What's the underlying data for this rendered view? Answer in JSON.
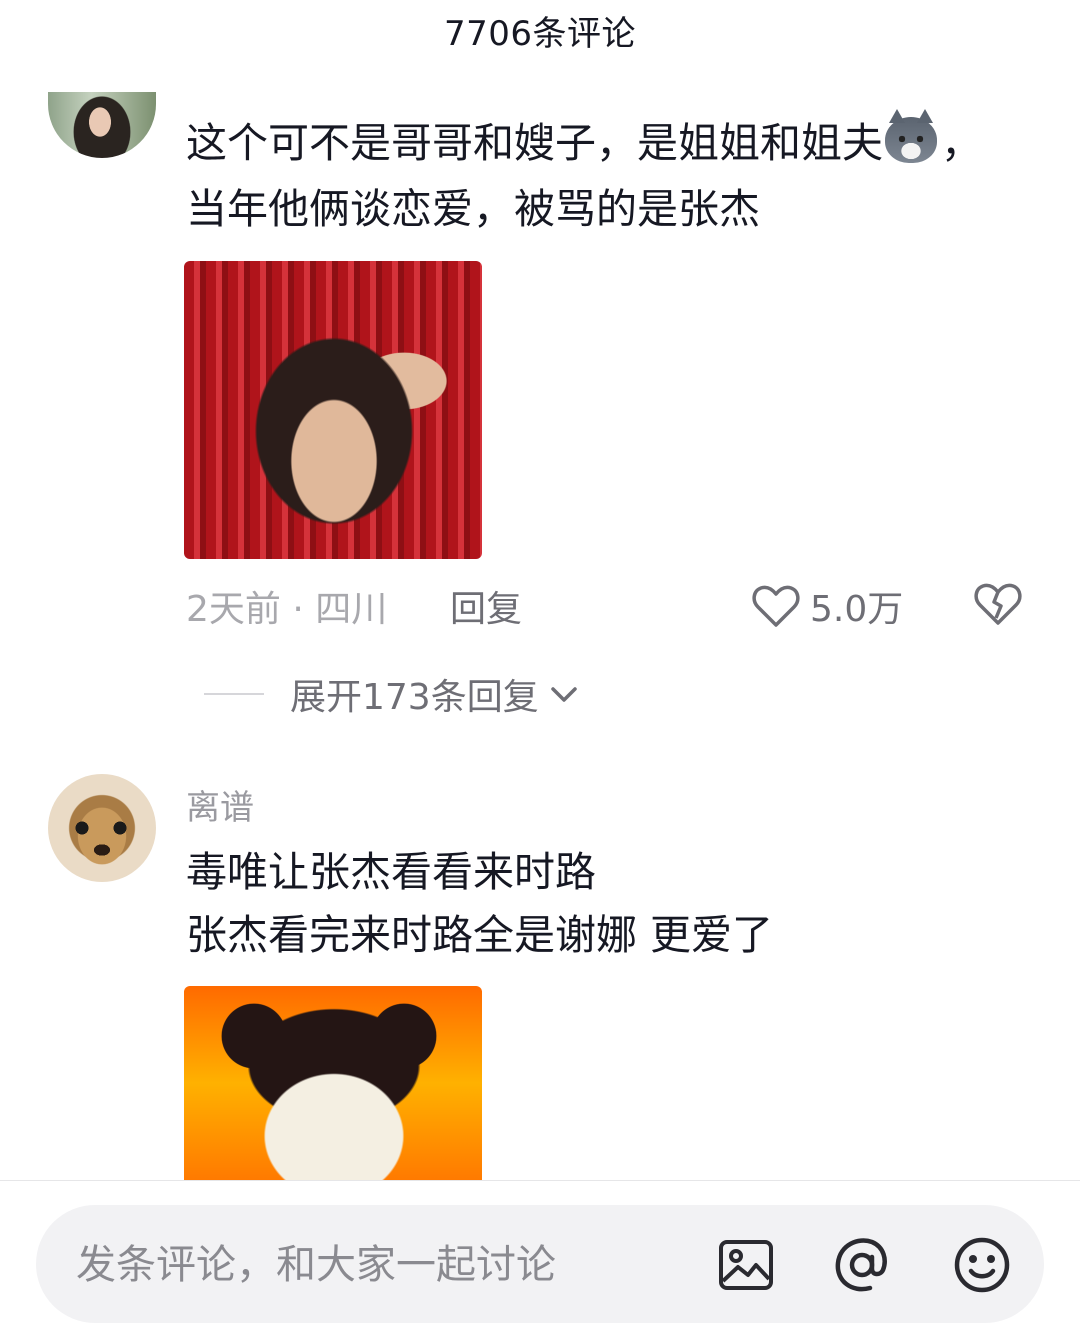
{
  "header": {
    "title": "7706条评论"
  },
  "comments": [
    {
      "username": "",
      "text_part1": "这个可不是哥哥和嫂子，是姐姐和姐夫",
      "text_part2": "，\n当年他俩谈恋爱，被骂的是张杰",
      "emoji": "wolf-face-emoji",
      "time_location": "2天前 · 四川",
      "reply_label": "回复",
      "likes": "5.0万",
      "expand_label": "展开173条回复"
    },
    {
      "username": "离谱",
      "text": "毒唯让张杰看看来时路\n张杰看完来时路全是谢娜 更爱了"
    }
  ],
  "input": {
    "placeholder": "发条评论，和大家一起讨论"
  },
  "icons": {
    "like": "heart-outline-icon",
    "dislike": "broken-heart-icon",
    "expand": "chevron-down-icon",
    "image": "image-icon",
    "mention": "at-icon",
    "emoji": "smiley-icon"
  },
  "colors": {
    "text": "#161823",
    "secondary": "#a8a8ad",
    "input_bg": "#f2f2f4"
  }
}
